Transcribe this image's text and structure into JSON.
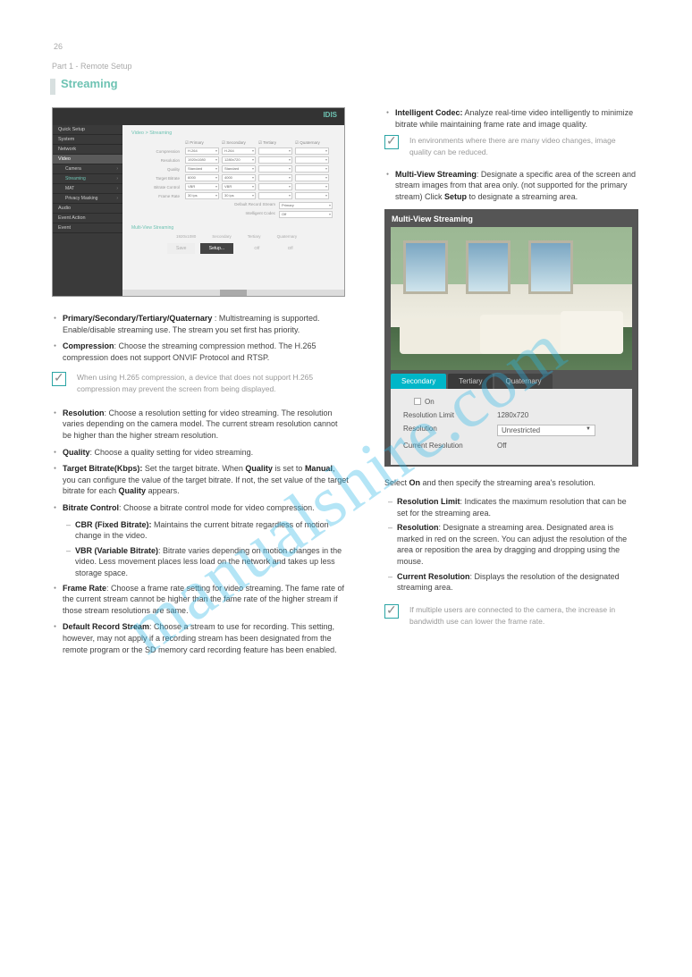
{
  "page_number": "26",
  "section_header_top": "Part 1 - Remote Setup",
  "section_title": "Streaming",
  "watermark": "manualshire.com",
  "ss1": {
    "logo": "IDIS",
    "sidebar": [
      {
        "label": "Quick Setup",
        "cls": ""
      },
      {
        "label": "System",
        "cls": ""
      },
      {
        "label": "Network",
        "cls": ""
      },
      {
        "label": "Video",
        "cls": "on"
      },
      {
        "label": "Camera",
        "cls": "sub"
      },
      {
        "label": "Streaming",
        "cls": "sub highlight"
      },
      {
        "label": "MAT",
        "cls": "sub"
      },
      {
        "label": "Privacy Masking",
        "cls": "sub"
      },
      {
        "label": "Audio",
        "cls": ""
      },
      {
        "label": "Event Action",
        "cls": ""
      },
      {
        "label": "Event",
        "cls": ""
      }
    ],
    "main_title": "Video > Streaming",
    "col_headers": [
      "☑ Primary",
      "☑ Secondary",
      "☑ Tertiary",
      "☑ Quaternary"
    ],
    "rows": [
      {
        "label": "Compression",
        "vals": [
          "H.264",
          "H.264",
          "",
          ""
        ]
      },
      {
        "label": "Resolution",
        "vals": [
          "1920x1080",
          "1280x720",
          "",
          ""
        ]
      },
      {
        "label": "Quality",
        "vals": [
          "Standard",
          "Standard",
          "",
          ""
        ]
      },
      {
        "label": "Target Bitrate",
        "vals": [
          "6000",
          "4000",
          "",
          ""
        ]
      },
      {
        "label": "Bitrate Control",
        "vals": [
          "VBR",
          "VBR",
          "",
          ""
        ]
      },
      {
        "label": "Frame Rate",
        "vals": [
          "30 ips",
          "30 ips",
          "",
          ""
        ]
      }
    ],
    "lower_left_label": "Default Record Stream",
    "lower_left_val": "Primary",
    "lower_right_label": "Intelligent Codec",
    "lower_right_val": "Off",
    "multi_section": "Multi-View Streaming",
    "multi_table": [
      "",
      "1920x1080",
      "Secondary",
      "Tertiary",
      "Quaternary"
    ],
    "buttons": [
      "Save",
      "Setup...",
      "Off",
      "Off"
    ]
  },
  "ss2": {
    "title": "Multi-View Streaming",
    "tabs": [
      "Secondary",
      "Tertiary",
      "Quaternary"
    ],
    "on_label": "On",
    "rows": [
      {
        "label": "Resolution Limit",
        "val": "1280x720"
      },
      {
        "label": "Resolution",
        "val": "Unrestricted",
        "dropdown": true
      },
      {
        "label": "Current Resolution",
        "val": "Off"
      }
    ]
  },
  "left_bullets": [
    {
      "html": "<b>Primary/Secondary/Tertiary/Quaternary</b> : Multistreaming is supported. Enable/disable streaming use. The stream you set first has priority."
    },
    {
      "html": "<b>Compression</b>: Choose the streaming compression method. The H.265 compression does not support ONVIF Protocol and RTSP."
    }
  ],
  "left_note": "When using H.265 compression, a device that does not support H.265 compression may prevent the screen from being displayed.",
  "left_bullets2": [
    {
      "html": "<b>Resolution</b>: Choose a resolution setting for video streaming. The resolution varies depending on the camera model. The current stream resolution cannot be higher than the higher stream resolution."
    },
    {
      "html": "<b>Quality</b>: Choose a quality setting for video streaming."
    },
    {
      "html": "<b>Target Bitrate(Kbps):</b> Set the target bitrate. When <b>Quality</b> is set to <b>Manual</b>, you can configure the value of the target bitrate. If not, the set value of the target bitrate for each <b>Quality</b> appears."
    },
    {
      "html": "<b>Bitrate Control</b>: Choose a bitrate control mode for video compression."
    },
    {
      "html": "<b>CBR (Fixed Bitrate):</b> Maintains the current bitrate regardless of motion change in the video.",
      "sub": true
    },
    {
      "html": "<b>VBR (Variable Bitrate)</b>: Bitrate varies depending on motion changes in the video. Less movement places less load on the network and takes up less storage space.",
      "sub": true
    },
    {
      "html": "<b>Frame Rate</b>: Choose a frame rate setting for video streaming. The fame rate of the current stream cannot be higher than the fame rate of the higher stream if those stream resolutions are same."
    },
    {
      "html": "<b>Default Record Stream</b>: Choose a stream to use for recording. This setting, however, may not apply if a recording stream has been designated from the remote program or the SD memory card recording feature has been enabled."
    }
  ],
  "right_bullets": [
    {
      "html": "<b>Intelligent Codec:</b> Analyze real-time video intelligently to minimize bitrate while maintaining frame rate and image quality."
    }
  ],
  "right_note1": "In environments where there are many video changes, image quality can be reduced.",
  "right_bullets2": [
    {
      "html": "<b>Multi-View Streaming</b>: Designate a specific area of the screen and stream images from that area only. (not supported for the primary stream) Click <b>Setup</b> to designate a streaming area."
    }
  ],
  "right_mid_para": "Select <b>On</b> and then specify the streaming area's resolution.",
  "right_subitems": [
    {
      "html": "<b>Resolution Limit</b>: Indicates the maximum resolution that can be set for the streaming area."
    },
    {
      "html": "<b>Resolution</b>: Designate a streaming area. Designated area is marked in red on the screen. You can adjust the resolution of the area or reposition the area by dragging and dropping using the mouse."
    },
    {
      "html": "<b>Current Resolution</b>: Displays the resolution of the designated streaming area."
    }
  ],
  "right_note2": "If multiple users are connected to the camera, the increase in bandwidth use can lower the frame rate."
}
